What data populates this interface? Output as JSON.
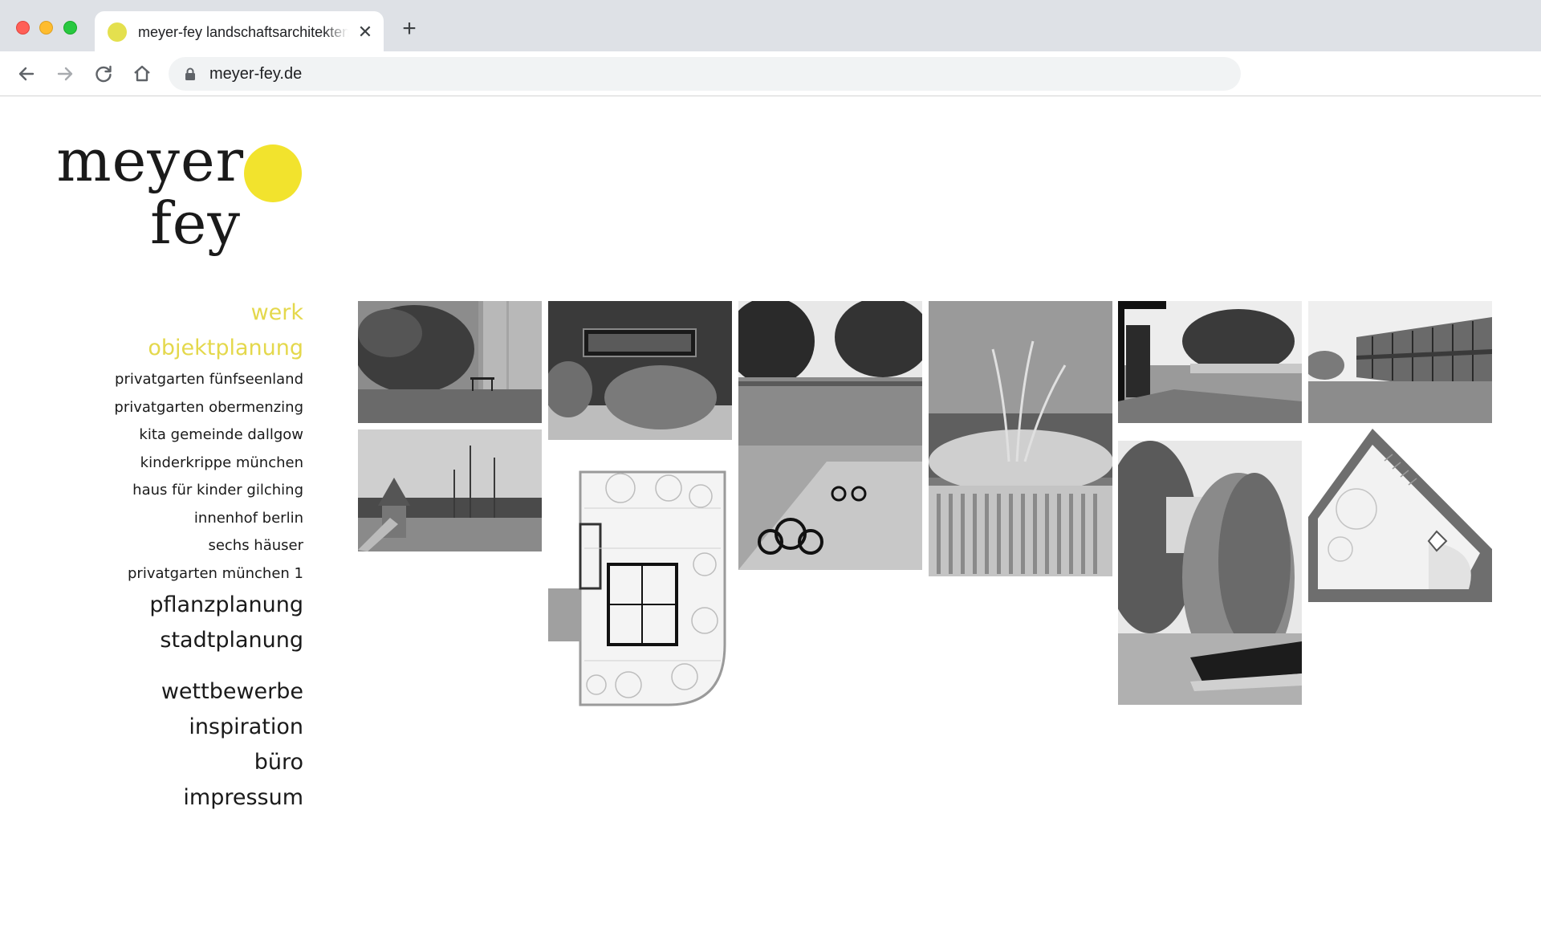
{
  "browser": {
    "tab_title": "meyer-fey landschaftsarchitekten",
    "url": "meyer-fey.de",
    "colors": {
      "favicon": "#e4e04e",
      "tabbar": "#dee1e6"
    }
  },
  "logo": {
    "line1": "meyer",
    "line2": "fey",
    "dot_color": "#f2e32d"
  },
  "nav": {
    "werk": "werk",
    "objektplanung": "objektplanung",
    "projects": [
      "privatgarten fünfseenland",
      "privatgarten obermenzing",
      "kita gemeinde dallgow",
      "kinderkrippe münchen",
      "haus für kinder gilching",
      "innenhof berlin",
      "sechs häuser",
      "privatgarten münchen 1"
    ],
    "pflanzplanung": "pflanzplanung",
    "stadtplanung": "stadtplanung",
    "wettbewerbe": "wettbewerbe",
    "inspiration": "inspiration",
    "buero": "büro",
    "impressum": "impressum",
    "active_color": "#e4d84c"
  },
  "gallery": {
    "count": 10,
    "items": [
      "garden-bench-photo",
      "dark-wall-window-photo",
      "kita-playground-tricycle-photo",
      "grass-fence-photo",
      "pavilion-lake-photo",
      "long-building-courtyard-photo",
      "playground-slide-photo",
      "floor-plan-drawing",
      "ornamental-grass-garden-photo",
      "courtyard-site-plan-drawing"
    ]
  }
}
